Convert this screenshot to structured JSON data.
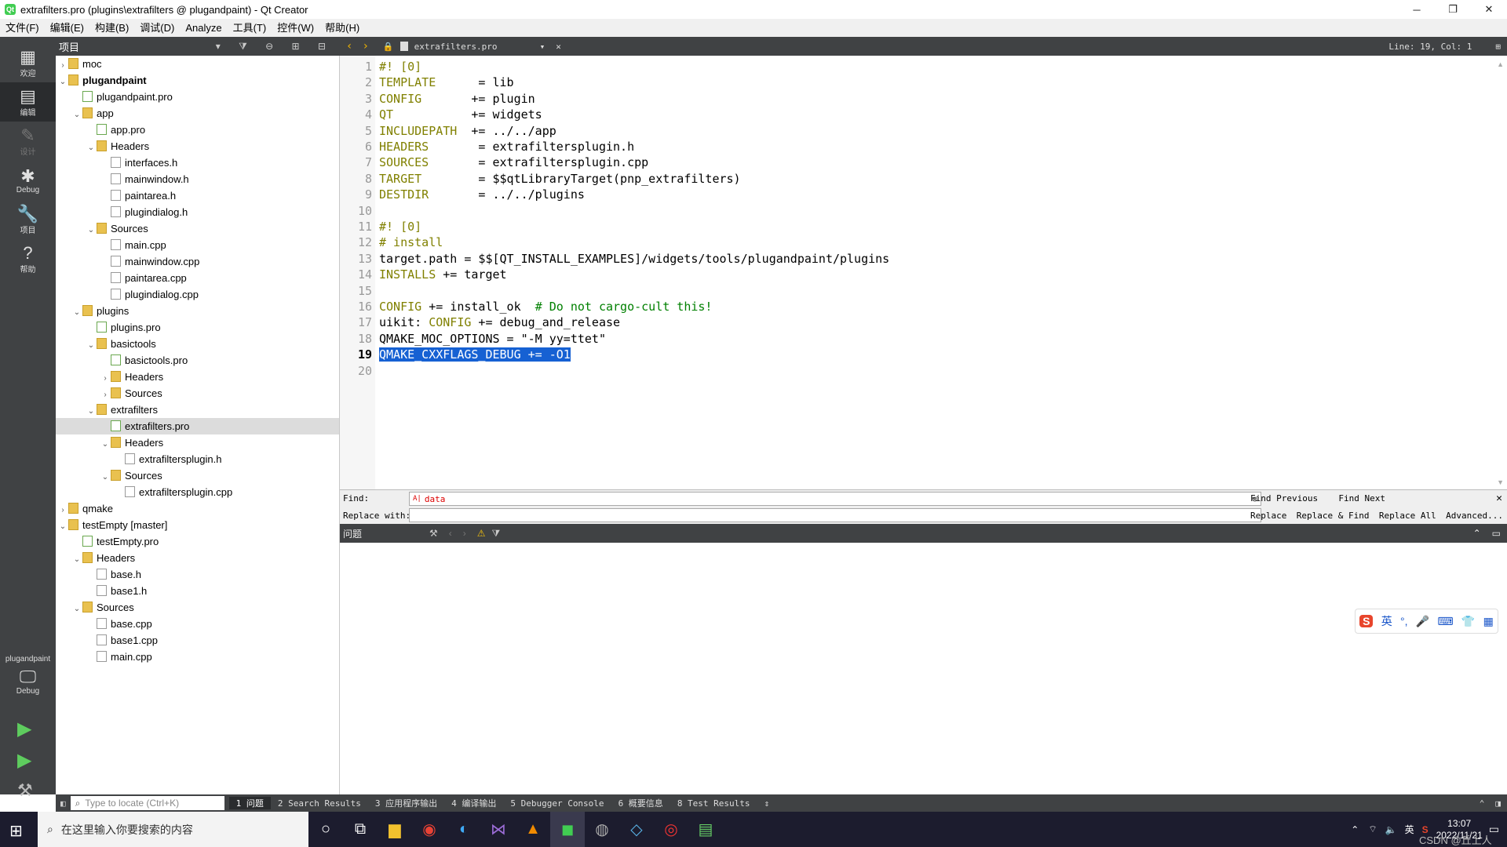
{
  "window": {
    "title": "extrafilters.pro (plugins\\extrafilters @ plugandpaint) - Qt Creator",
    "controls": [
      "─",
      "❐",
      "✕"
    ]
  },
  "menu": [
    "文件(F)",
    "编辑(E)",
    "构建(B)",
    "调试(D)",
    "Analyze",
    "工具(T)",
    "控件(W)",
    "帮助(H)"
  ],
  "modes": [
    {
      "label": "欢迎",
      "icon": "grid-icon"
    },
    {
      "label": "编辑",
      "icon": "edit-icon"
    },
    {
      "label": "设计",
      "icon": "pencil-icon"
    },
    {
      "label": "Debug",
      "icon": "bug-icon"
    },
    {
      "label": "项目",
      "icon": "wrench-icon"
    },
    {
      "label": "帮助",
      "icon": "help-icon"
    }
  ],
  "target": {
    "project": "plugandpaint",
    "config": "Debug"
  },
  "project_panel": {
    "title": "项目"
  },
  "tree": [
    {
      "label": "moc",
      "depth": 0,
      "arrow": ">",
      "icon": "fold",
      "bold": false
    },
    {
      "label": "plugandpaint",
      "depth": 0,
      "arrow": "v",
      "icon": "fold",
      "bold": true
    },
    {
      "label": "plugandpaint.pro",
      "depth": 1,
      "arrow": "",
      "icon": "pro",
      "bold": false
    },
    {
      "label": "app",
      "depth": 1,
      "arrow": "v",
      "icon": "fold",
      "bold": false
    },
    {
      "label": "app.pro",
      "depth": 2,
      "arrow": "",
      "icon": "pro",
      "bold": false
    },
    {
      "label": "Headers",
      "depth": 2,
      "arrow": "v",
      "icon": "fold",
      "bold": false
    },
    {
      "label": "interfaces.h",
      "depth": 3,
      "arrow": "",
      "icon": "file",
      "bold": false
    },
    {
      "label": "mainwindow.h",
      "depth": 3,
      "arrow": "",
      "icon": "file",
      "bold": false
    },
    {
      "label": "paintarea.h",
      "depth": 3,
      "arrow": "",
      "icon": "file",
      "bold": false
    },
    {
      "label": "plugindialog.h",
      "depth": 3,
      "arrow": "",
      "icon": "file",
      "bold": false
    },
    {
      "label": "Sources",
      "depth": 2,
      "arrow": "v",
      "icon": "fold",
      "bold": false
    },
    {
      "label": "main.cpp",
      "depth": 3,
      "arrow": "",
      "icon": "file",
      "bold": false
    },
    {
      "label": "mainwindow.cpp",
      "depth": 3,
      "arrow": "",
      "icon": "file",
      "bold": false
    },
    {
      "label": "paintarea.cpp",
      "depth": 3,
      "arrow": "",
      "icon": "file",
      "bold": false
    },
    {
      "label": "plugindialog.cpp",
      "depth": 3,
      "arrow": "",
      "icon": "file",
      "bold": false
    },
    {
      "label": "plugins",
      "depth": 1,
      "arrow": "v",
      "icon": "fold",
      "bold": false
    },
    {
      "label": "plugins.pro",
      "depth": 2,
      "arrow": "",
      "icon": "pro",
      "bold": false
    },
    {
      "label": "basictools",
      "depth": 2,
      "arrow": "v",
      "icon": "fold",
      "bold": false
    },
    {
      "label": "basictools.pro",
      "depth": 3,
      "arrow": "",
      "icon": "pro",
      "bold": false
    },
    {
      "label": "Headers",
      "depth": 3,
      "arrow": ">",
      "icon": "fold",
      "bold": false
    },
    {
      "label": "Sources",
      "depth": 3,
      "arrow": ">",
      "icon": "fold",
      "bold": false
    },
    {
      "label": "extrafilters",
      "depth": 2,
      "arrow": "v",
      "icon": "fold",
      "bold": false
    },
    {
      "label": "extrafilters.pro",
      "depth": 3,
      "arrow": "",
      "icon": "pro",
      "bold": false,
      "selected": true
    },
    {
      "label": "Headers",
      "depth": 3,
      "arrow": "v",
      "icon": "fold",
      "bold": false
    },
    {
      "label": "extrafiltersplugin.h",
      "depth": 4,
      "arrow": "",
      "icon": "file",
      "bold": false
    },
    {
      "label": "Sources",
      "depth": 3,
      "arrow": "v",
      "icon": "fold",
      "bold": false
    },
    {
      "label": "extrafiltersplugin.cpp",
      "depth": 4,
      "arrow": "",
      "icon": "file",
      "bold": false
    },
    {
      "label": "qmake",
      "depth": 0,
      "arrow": ">",
      "icon": "fold",
      "bold": false
    },
    {
      "label": "testEmpty [master]",
      "depth": 0,
      "arrow": "v",
      "icon": "fold",
      "bold": false
    },
    {
      "label": "testEmpty.pro",
      "depth": 1,
      "arrow": "",
      "icon": "pro",
      "bold": false
    },
    {
      "label": "Headers",
      "depth": 1,
      "arrow": "v",
      "icon": "fold",
      "bold": false
    },
    {
      "label": "base.h",
      "depth": 2,
      "arrow": "",
      "icon": "file",
      "bold": false
    },
    {
      "label": "base1.h",
      "depth": 2,
      "arrow": "",
      "icon": "file",
      "bold": false
    },
    {
      "label": "Sources",
      "depth": 1,
      "arrow": "v",
      "icon": "fold",
      "bold": false
    },
    {
      "label": "base.cpp",
      "depth": 2,
      "arrow": "",
      "icon": "file",
      "bold": false
    },
    {
      "label": "base1.cpp",
      "depth": 2,
      "arrow": "",
      "icon": "file",
      "bold": false
    },
    {
      "label": "main.cpp",
      "depth": 2,
      "arrow": "",
      "icon": "file",
      "bold": false
    }
  ],
  "editor": {
    "filename": "extrafilters.pro",
    "cursor": "Line: 19, Col: 1",
    "current_line": 19,
    "lines": [
      [
        {
          "t": "#! [0]",
          "c": "kw"
        }
      ],
      [
        {
          "t": "TEMPLATE",
          "c": "kw"
        },
        {
          "t": "      = lib",
          "c": ""
        }
      ],
      [
        {
          "t": "CONFIG",
          "c": "kw"
        },
        {
          "t": "       += plugin",
          "c": ""
        }
      ],
      [
        {
          "t": "QT",
          "c": "kw"
        },
        {
          "t": "           += widgets",
          "c": ""
        }
      ],
      [
        {
          "t": "INCLUDEPATH",
          "c": "kw"
        },
        {
          "t": "  += ../../app",
          "c": ""
        }
      ],
      [
        {
          "t": "HEADERS",
          "c": "kw"
        },
        {
          "t": "       = extrafiltersplugin.h",
          "c": ""
        }
      ],
      [
        {
          "t": "SOURCES",
          "c": "kw"
        },
        {
          "t": "       = extrafiltersplugin.cpp",
          "c": ""
        }
      ],
      [
        {
          "t": "TARGET",
          "c": "kw"
        },
        {
          "t": "        = $$qtLibraryTarget(pnp_extrafilters)",
          "c": ""
        }
      ],
      [
        {
          "t": "DESTDIR",
          "c": "kw"
        },
        {
          "t": "       = ../../plugins",
          "c": ""
        }
      ],
      [],
      [
        {
          "t": "#! [0]",
          "c": "kw"
        }
      ],
      [
        {
          "t": "# install",
          "c": "kw"
        }
      ],
      [
        {
          "t": "target.path = $$[QT_INSTALL_EXAMPLES]/widgets/tools/plugandpaint/plugins",
          "c": ""
        }
      ],
      [
        {
          "t": "INSTALLS",
          "c": "kw"
        },
        {
          "t": " += target",
          "c": ""
        }
      ],
      [],
      [
        {
          "t": "CONFIG",
          "c": "kw"
        },
        {
          "t": " += install_ok  ",
          "c": ""
        },
        {
          "t": "# Do not cargo-cult this!",
          "c": "cm"
        }
      ],
      [
        {
          "t": "uikit: ",
          "c": ""
        },
        {
          "t": "CONFIG",
          "c": "kw"
        },
        {
          "t": " += debug_and_release",
          "c": ""
        }
      ],
      [
        {
          "t": "QMAKE_MOC_OPTIONS = \"-M yy=ttet\"",
          "c": ""
        }
      ],
      [
        {
          "t": "QMAKE_CXXFLAGS_DEBUG += -O1",
          "c": "sel-code"
        }
      ],
      []
    ]
  },
  "find": {
    "find_label": "Find:",
    "replace_label": "Replace with:",
    "find_value": "data",
    "replace_value": "",
    "buttons": [
      "Find Previous",
      "Find Next",
      "Replace",
      "Replace & Find",
      "Replace All",
      "Advanced..."
    ]
  },
  "output": {
    "title": "问题"
  },
  "status": {
    "locate_placeholder": "Type to locate (Ctrl+K)",
    "panes": [
      "1 问题",
      "2 Search Results",
      "3 应用程序输出",
      "4 编译输出",
      "5 Debugger Console",
      "6 概要信息",
      "8 Test Results"
    ]
  },
  "taskbar": {
    "search_placeholder": "在这里输入你要搜索的内容",
    "time": "13:07",
    "date": "2022/11/21",
    "ime": "英",
    "watermark": "CSDN @丘上人"
  },
  "ime_bar": [
    "英",
    "°,",
    "🎤",
    "⌨",
    "👕",
    "▦"
  ],
  "colors": {
    "keyword": "#808000",
    "comment": "#008000",
    "selection": "#1661d3",
    "sidebar": "#404244"
  }
}
